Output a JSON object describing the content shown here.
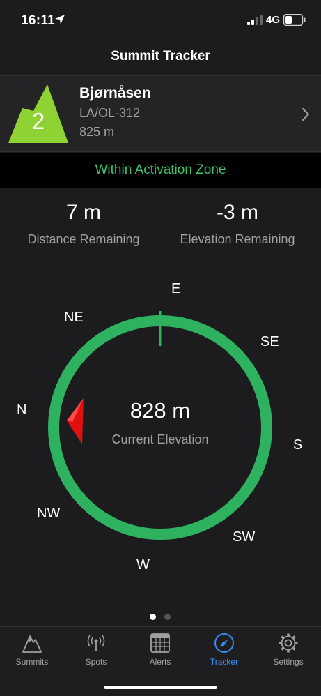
{
  "status_bar": {
    "time": "16:11",
    "network": "4G",
    "icons": [
      "location-arrow-icon",
      "signal-icon",
      "battery-icon"
    ]
  },
  "nav": {
    "title": "Summit Tracker"
  },
  "summit": {
    "points": "2",
    "name": "Bjørnåsen",
    "reference": "LA/OL-312",
    "altitude": "825 m",
    "badge_color": "#8fd233"
  },
  "zone": {
    "status": "Within Activation Zone",
    "color": "#3cc36c"
  },
  "metrics": {
    "distance_value": "7 m",
    "distance_label": "Distance Remaining",
    "elevation_value": "-3 m",
    "elevation_label": "Elevation Remaining"
  },
  "compass": {
    "directions": {
      "E": "E",
      "SE": "SE",
      "S": "S",
      "SW": "SW",
      "W": "W",
      "NW": "NW",
      "N": "N",
      "NE": "NE"
    },
    "current_elevation": "828 m",
    "current_elevation_label": "Current Elevation",
    "ring_color": "#2eb260",
    "pointer_color": "#e01010"
  },
  "pager": {
    "page": 1,
    "total": 2
  },
  "tabs": [
    {
      "label": "Summits",
      "icon": "mountain-icon",
      "active": false
    },
    {
      "label": "Spots",
      "icon": "antenna-icon",
      "active": false
    },
    {
      "label": "Alerts",
      "icon": "calendar-icon",
      "active": false
    },
    {
      "label": "Tracker",
      "icon": "compass-icon",
      "active": true
    },
    {
      "label": "Settings",
      "icon": "gear-icon",
      "active": false
    }
  ]
}
